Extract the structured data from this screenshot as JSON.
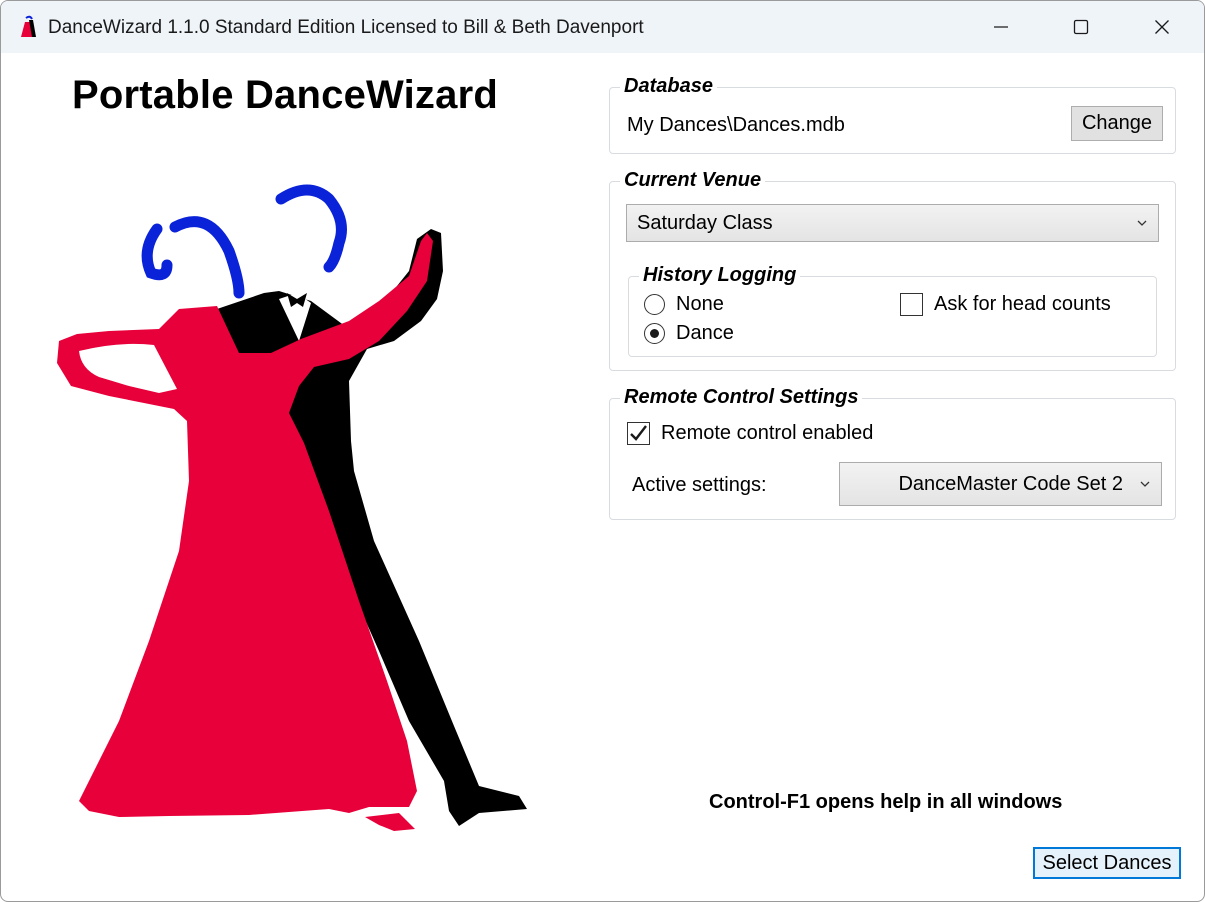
{
  "window": {
    "title": "DanceWizard 1.1.0 Standard Edition Licensed to Bill & Beth Davenport"
  },
  "heading": "Portable DanceWizard",
  "database": {
    "legend": "Database",
    "path": "My Dances\\Dances.mdb",
    "change_label": "Change"
  },
  "venue": {
    "legend": "Current Venue",
    "selected": "Saturday Class",
    "history": {
      "legend": "History Logging",
      "options": [
        "None",
        "Dance"
      ],
      "selected": "Dance",
      "head_counts_label": "Ask for head counts",
      "head_counts_checked": false
    }
  },
  "remote": {
    "legend": "Remote Control Settings",
    "enabled_label": "Remote control enabled",
    "enabled_checked": true,
    "active_label": "Active settings:",
    "active_selected": "DanceMaster Code Set 2"
  },
  "help_note": "Control-F1 opens help in all windows",
  "select_dances_label": "Select Dances",
  "colors": {
    "dress": "#e8003a",
    "suit": "#000000",
    "heads": "#0a22d8",
    "accent": "#0078d7"
  }
}
